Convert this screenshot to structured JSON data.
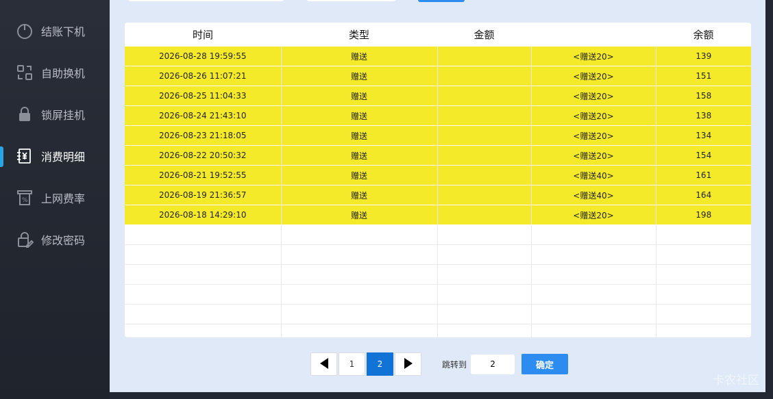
{
  "sidebar": {
    "items": [
      {
        "label": "结账下机",
        "icon": "power-icon"
      },
      {
        "label": "自助换机",
        "icon": "switch-icon"
      },
      {
        "label": "锁屏挂机",
        "icon": "lock-icon"
      },
      {
        "label": "消费明细",
        "icon": "receipt-yen-icon",
        "active": true
      },
      {
        "label": "上网费率",
        "icon": "rate-icon"
      },
      {
        "label": "修改密码",
        "icon": "edit-lock-icon"
      }
    ]
  },
  "table": {
    "headers": [
      "时间",
      "类型",
      "金额",
      "",
      "余额"
    ],
    "rows": [
      [
        "2026-08-28 19:59:55",
        "赠送",
        "",
        "<赠送20>",
        "139"
      ],
      [
        "2026-08-26 11:07:21",
        "赠送",
        "",
        "<赠送20>",
        "151"
      ],
      [
        "2026-08-25 11:04:33",
        "赠送",
        "",
        "<赠送20>",
        "158"
      ],
      [
        "2026-08-24 21:43:10",
        "赠送",
        "",
        "<赠送20>",
        "138"
      ],
      [
        "2026-08-23 21:18:05",
        "赠送",
        "",
        "<赠送20>",
        "134"
      ],
      [
        "2026-08-22 20:50:32",
        "赠送",
        "",
        "<赠送20>",
        "154"
      ],
      [
        "2026-08-21 19:52:55",
        "赠送",
        "",
        "<赠送40>",
        "161"
      ],
      [
        "2026-08-19 21:36:57",
        "赠送",
        "",
        "<赠送40>",
        "164"
      ],
      [
        "2026-08-18 14:29:10",
        "赠送",
        "",
        "<赠送20>",
        "198"
      ]
    ],
    "empty_rows": 6
  },
  "pagination": {
    "pages": [
      "1",
      "2"
    ],
    "current": "2",
    "jump_label": "跳转到",
    "jump_value": "2",
    "confirm_label": "确定"
  },
  "watermark": "卡农社区",
  "colors": {
    "row_highlight": "#f5ea29",
    "accent": "#2d8cf0",
    "active_indicator": "#29a4e6",
    "panel_bg": "#dfe9f8"
  }
}
